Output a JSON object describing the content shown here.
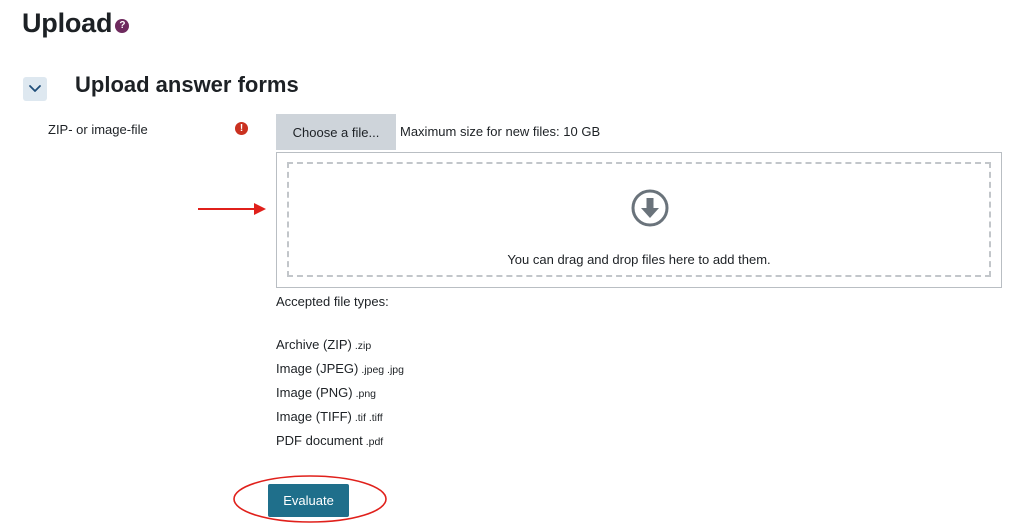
{
  "page": {
    "title": "Upload",
    "help_icon": "question-icon",
    "help_glyph": "?"
  },
  "section": {
    "title": "Upload answer forms",
    "expanded": true,
    "toggle_icon": "chevron-down-icon"
  },
  "file_field": {
    "label": "ZIP- or image-file",
    "required_icon": "exclamation-icon",
    "required_glyph": "!",
    "choose_button_label": "Choose a file...",
    "max_size_text": "Maximum size for new files: 10 GB",
    "dropzone_text": "You can drag and drop files here to add them.",
    "drop_icon": "download-circle-icon"
  },
  "accepted_types": {
    "heading": "Accepted file types:",
    "items": [
      {
        "name": "Archive (ZIP)",
        "ext": ".zip"
      },
      {
        "name": "Image (JPEG)",
        "ext": ".jpeg .jpg"
      },
      {
        "name": "Image (PNG)",
        "ext": ".png"
      },
      {
        "name": "Image (TIFF)",
        "ext": ".tif .tiff"
      },
      {
        "name": "PDF document",
        "ext": ".pdf"
      }
    ]
  },
  "actions": {
    "evaluate_label": "Evaluate"
  },
  "colors": {
    "primary_button": "#1f6f8b",
    "annotation_red": "#e0201b",
    "required_red": "#ca3120",
    "help_purple": "#6e2a5e"
  }
}
